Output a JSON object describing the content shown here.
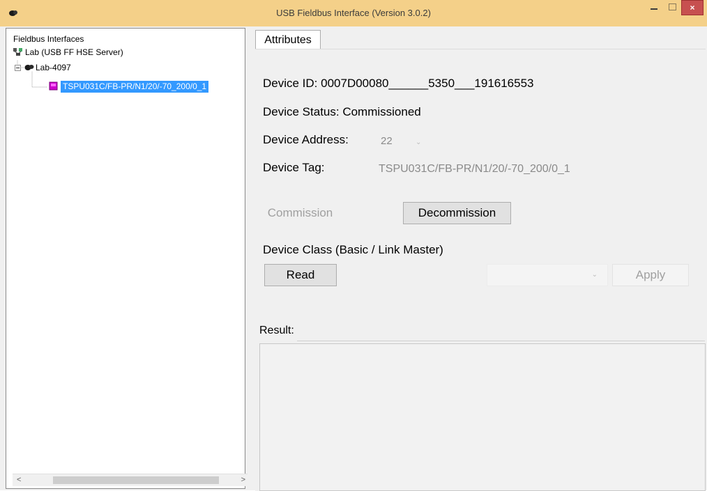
{
  "window": {
    "title": "USB Fieldbus Interface (Version 3.0.2)",
    "close_label": "×"
  },
  "tree": {
    "root_label": "Fieldbus Interfaces",
    "server_label": "Lab (USB FF HSE Server)",
    "node_label": "Lab-4097",
    "device_label": "TSPU031C/FB-PR/N1/20/-70_200/0_1"
  },
  "scroll": {
    "left_arrow": "<",
    "right_arrow": ">"
  },
  "tabs": [
    {
      "label": "Attributes"
    }
  ],
  "attributes": {
    "device_id": "Device ID:  0007D00080______5350___191616553",
    "device_status": "Device Status:  Commissioned",
    "device_address_label": "Device Address:",
    "device_address_value": "22",
    "device_tag_label": "Device Tag:",
    "device_tag_value": "TSPU031C/FB-PR/N1/20/-70_200/0_1",
    "commission_label": "Commission",
    "decommission_label": "Decommission",
    "device_class_label": "Device Class (Basic / Link Master)",
    "read_label": "Read",
    "apply_label": "Apply",
    "result_label": "Result:"
  },
  "colors": {
    "titlebar": "#f4d089",
    "selection": "#3399ff",
    "close_button": "#c75050"
  }
}
